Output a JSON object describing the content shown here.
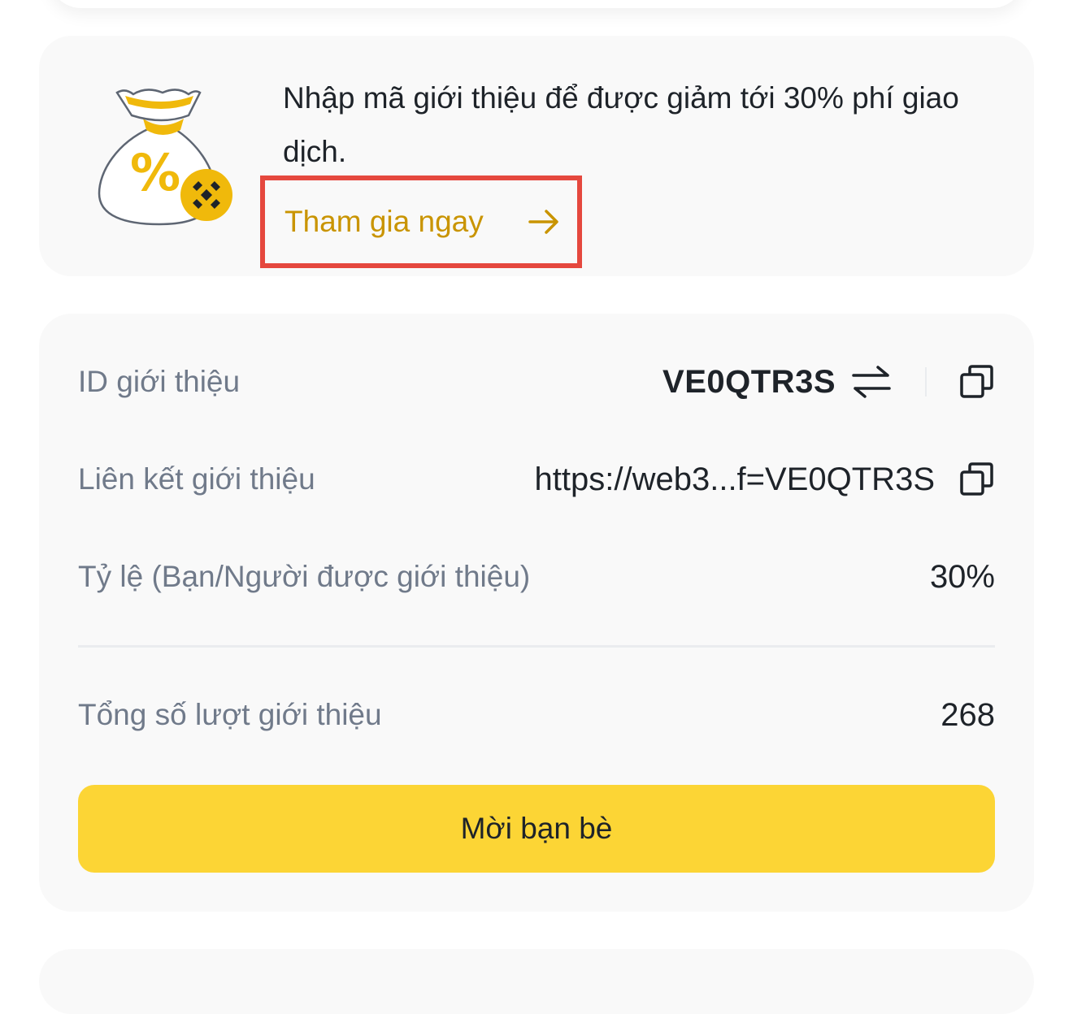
{
  "promo": {
    "message": "Nhập mã giới thiệu để được giảm tới 30% phí giao dịch.",
    "cta_label": "Tham gia ngay"
  },
  "referral": {
    "id_label": "ID giới thiệu",
    "id_value": "VE0QTR3S",
    "link_label": "Liên kết giới thiệu",
    "link_value": "https://web3...f=VE0QTR3S",
    "ratio_label": "Tỷ lệ (Bạn/Người được giới thiệu)",
    "ratio_value": "30%",
    "total_label": "Tổng số lượt giới thiệu",
    "total_value": "268",
    "invite_button": "Mời bạn bè"
  },
  "colors": {
    "accent_yellow": "#fcd535",
    "link_gold": "#c99400",
    "highlight_red": "#e5483e",
    "label_gray": "#707a8a",
    "text_dark": "#1e2329"
  },
  "icons": {
    "bag": "money-bag-percent-icon",
    "arrow": "arrow-right-icon",
    "swap": "swap-arrows-icon",
    "copy": "copy-icon"
  }
}
